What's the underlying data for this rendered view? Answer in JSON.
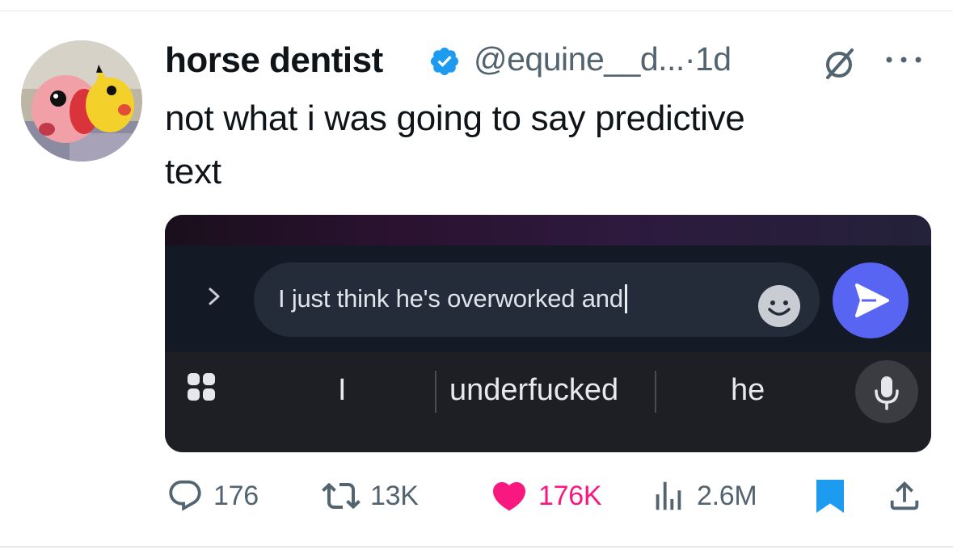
{
  "tweet": {
    "author": {
      "name": "horse dentist",
      "handle": "@equine__d...",
      "separator": "·",
      "time": "1d",
      "verified": true,
      "avatar_icon": "avatar-image"
    },
    "text": "not what i was going to say predictive\ntext",
    "media": {
      "chat_input_text": "I just think he's overworked and",
      "suggestions": [
        "I",
        "underfucked",
        "he"
      ],
      "colors": {
        "send_button": "#5865f2",
        "chat_background": "#141a25",
        "keyboard_background": "#1d1f24"
      },
      "icons": [
        "chevron-right-icon",
        "emoji-icon",
        "send-icon",
        "keyboard-grid-icon",
        "microphone-icon"
      ]
    },
    "actions": {
      "replies": "176",
      "retweets": "13K",
      "likes": "176K",
      "views": "2.6M"
    },
    "colors": {
      "verified": "#1d9bf0",
      "like": "#f91880",
      "bookmark": "#1d9bf0",
      "muted_text": "#536471"
    }
  }
}
